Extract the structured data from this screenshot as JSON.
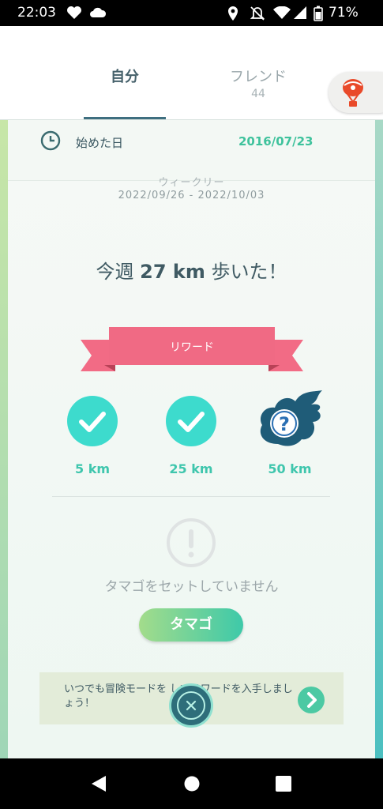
{
  "status_bar": {
    "time": "22:03",
    "battery": "71%"
  },
  "tabs": {
    "self_label": "自分",
    "friends_label": "フレンド",
    "friends_count": "44"
  },
  "profile": {
    "started_label": "始めた日",
    "started_date": "2016/07/23"
  },
  "weekly": {
    "label": "ウィークリー",
    "range": "2022/09/26 - 2022/10/03",
    "headline_pre": "今週 ",
    "headline_km": "27 km",
    "headline_post": " 歩いた！"
  },
  "rewards": {
    "title": "リワード",
    "tiers": [
      {
        "label": "5 km",
        "status": "completed"
      },
      {
        "label": "25 km",
        "status": "completed"
      },
      {
        "label": "50 km",
        "status": "unknown",
        "symbol": "?"
      }
    ]
  },
  "egg": {
    "message": "タマゴをセットしていません",
    "button_label": "タマゴ"
  },
  "adventure_banner": {
    "text": "いつでも冒険モードを      してリワードを入手しましょう！"
  },
  "colors": {
    "accent": "#3ec9a9",
    "ribbon": "#f26b85",
    "dark_teal": "#2e6e7a"
  },
  "icons": [
    "heart-icon",
    "cloud-icon",
    "location-icon",
    "bell-off-icon",
    "wifi-icon",
    "signal-icon",
    "battery-icon",
    "balloon-icon",
    "clock-icon",
    "check-icon",
    "question-icon",
    "alert-icon",
    "chevron-right-icon",
    "close-icon",
    "back-icon",
    "home-icon",
    "recents-icon"
  ]
}
